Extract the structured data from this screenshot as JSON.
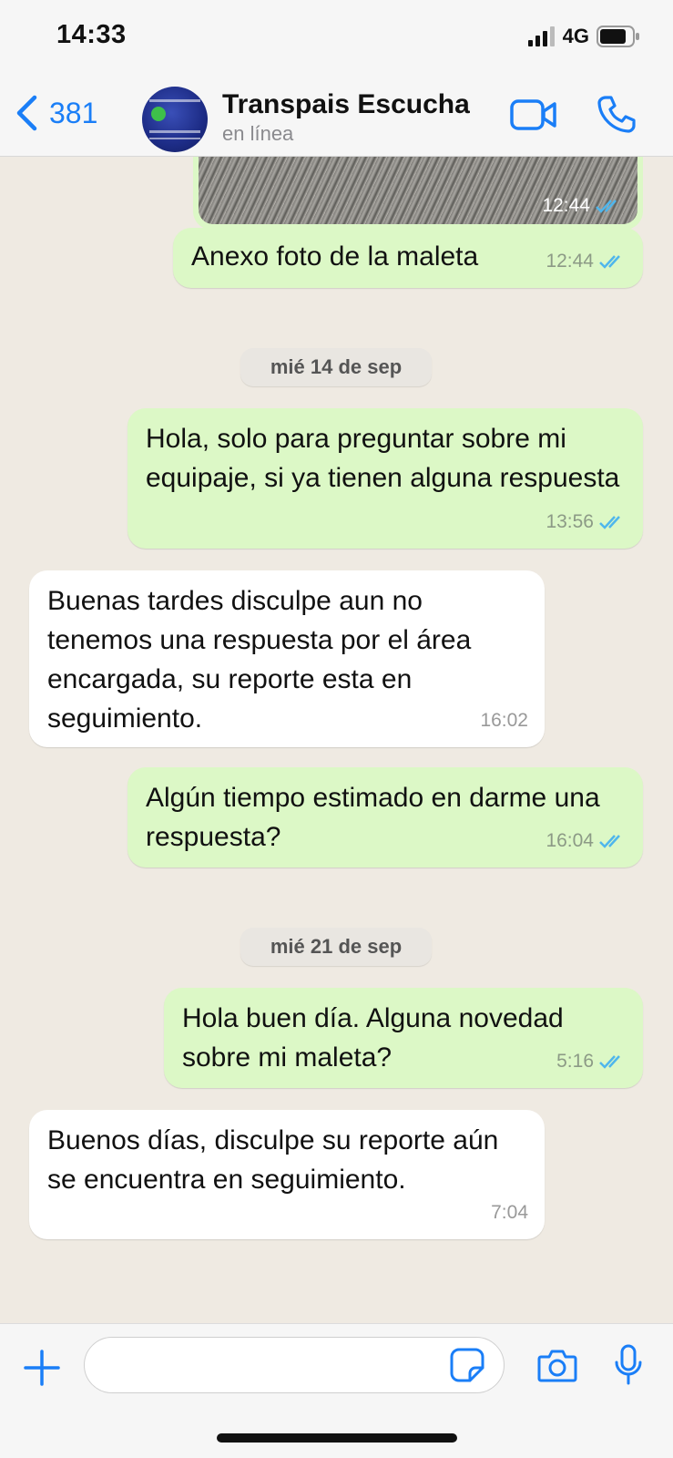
{
  "status_bar": {
    "time": "14:33",
    "network": "4G"
  },
  "header": {
    "back_count": "381",
    "contact_name": "Transpais Escucha",
    "contact_status": "en línea"
  },
  "messages": {
    "photo_time": "12:44",
    "m1": {
      "text": "Anexo foto de la maleta",
      "time": "12:44"
    },
    "date1": "mié 14 de sep",
    "m2": {
      "text": "Hola, solo para preguntar sobre mi equipaje, si ya tienen alguna respuesta",
      "time": "13:56"
    },
    "m3": {
      "text": "Buenas  tardes disculpe aun no tenemos una respuesta  por el área encargada, su reporte esta en seguimiento.",
      "time": "16:02"
    },
    "m4": {
      "text": "Algún tiempo estimado en darme una respuesta?",
      "time": "16:04"
    },
    "date2": "mié 21 de sep",
    "m5": {
      "text": "Hola buen día. Alguna novedad sobre mi maleta?",
      "time": "5:16"
    },
    "m6": {
      "text": "Buenos días, disculpe su reporte aún se encuentra en seguimiento.",
      "time": "7:04"
    }
  },
  "colors": {
    "accent": "#1a7ef7",
    "outgoing_bubble": "#dcf8c6",
    "incoming_bubble": "#ffffff",
    "read_ticks": "#4fb6ec"
  },
  "icons": [
    "back-chevron-icon",
    "video-call-icon",
    "phone-icon",
    "plus-icon",
    "sticker-icon",
    "camera-icon",
    "microphone-icon",
    "read-ticks-icon",
    "signal-icon",
    "battery-icon"
  ]
}
